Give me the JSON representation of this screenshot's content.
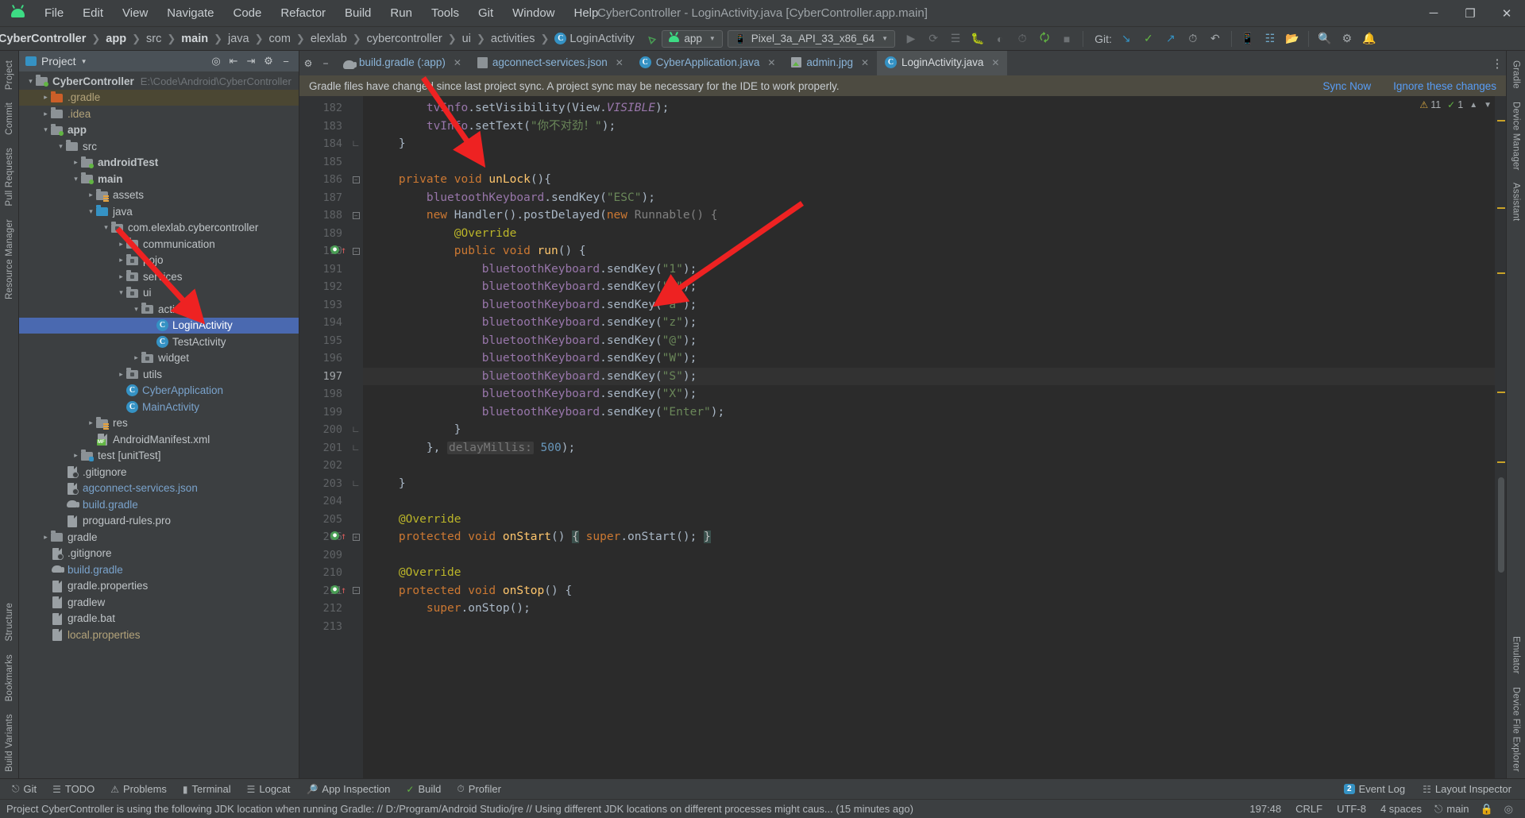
{
  "window": {
    "title": "CyberController - LoginActivity.java [CyberController.app.main]",
    "logo": "android-logo",
    "controls": {
      "minimize": "─",
      "maximize": "❐",
      "close": "✕"
    }
  },
  "menubar": {
    "items": [
      "File",
      "Edit",
      "View",
      "Navigate",
      "Code",
      "Refactor",
      "Build",
      "Run",
      "Tools",
      "Git",
      "Window",
      "Help"
    ]
  },
  "navbar": {
    "breadcrumbs": [
      "CyberController",
      "app",
      "src",
      "main",
      "java",
      "com",
      "elexlab",
      "cybercontroller",
      "ui",
      "activities",
      "LoginActivity"
    ],
    "module_selector": "app",
    "device_selector": "Pixel_3a_API_33_x86_64",
    "git_label": "Git:",
    "icons": [
      "run-icon",
      "rerun-icon",
      "apply-changes-icon",
      "debug-icon",
      "coverage-icon",
      "profiler-icon",
      "sync-gradle-icon",
      "stop-icon",
      "git-update-icon",
      "git-commit-icon",
      "git-push-icon",
      "history-icon",
      "undo-icon",
      "avd-manager-icon",
      "sdk-manager-icon",
      "device-explorer-icon",
      "search-icon",
      "settings-icon",
      "notifications-icon"
    ]
  },
  "project_panel": {
    "title": "Project",
    "header_icons": [
      "locate-icon",
      "expand-all-icon",
      "collapse-all-icon",
      "settings-icon",
      "hide-icon"
    ],
    "tree": [
      {
        "label": "CyberController",
        "path": "E:\\Code\\Android\\CyberController",
        "depth": 0,
        "arrow": "down",
        "icon": "module-folder",
        "bold": true
      },
      {
        "label": ".gradle",
        "depth": 1,
        "arrow": "right",
        "icon": "folder-orange",
        "color": "orange",
        "highlight": true
      },
      {
        "label": ".idea",
        "depth": 1,
        "arrow": "right",
        "icon": "folder",
        "color": "orange"
      },
      {
        "label": "app",
        "depth": 1,
        "arrow": "down",
        "icon": "module-folder",
        "bold": true
      },
      {
        "label": "src",
        "depth": 2,
        "arrow": "down",
        "icon": "folder"
      },
      {
        "label": "androidTest",
        "depth": 3,
        "arrow": "right",
        "icon": "module-folder",
        "bold": true
      },
      {
        "label": "main",
        "depth": 3,
        "arrow": "down",
        "icon": "module-folder",
        "bold": true
      },
      {
        "label": "assets",
        "depth": 4,
        "arrow": "right",
        "icon": "folder-res"
      },
      {
        "label": "java",
        "depth": 4,
        "arrow": "down",
        "icon": "folder-blue"
      },
      {
        "label": "com.elexlab.cybercontroller",
        "depth": 5,
        "arrow": "down",
        "icon": "package-folder"
      },
      {
        "label": "communication",
        "depth": 6,
        "arrow": "right",
        "icon": "package-folder"
      },
      {
        "label": "pojo",
        "depth": 6,
        "arrow": "right",
        "icon": "package-folder"
      },
      {
        "label": "services",
        "depth": 6,
        "arrow": "right",
        "icon": "package-folder"
      },
      {
        "label": "ui",
        "depth": 6,
        "arrow": "down",
        "icon": "package-folder"
      },
      {
        "label": "activities",
        "depth": 7,
        "arrow": "down",
        "icon": "package-folder"
      },
      {
        "label": "LoginActivity",
        "depth": 8,
        "arrow": "none",
        "icon": "java-class",
        "selected": true
      },
      {
        "label": "TestActivity",
        "depth": 8,
        "arrow": "none",
        "icon": "java-class"
      },
      {
        "label": "widget",
        "depth": 7,
        "arrow": "right",
        "icon": "package-folder"
      },
      {
        "label": "utils",
        "depth": 6,
        "arrow": "right",
        "icon": "package-folder"
      },
      {
        "label": "CyberApplication",
        "depth": 6,
        "arrow": "none",
        "icon": "java-class",
        "color": "blue"
      },
      {
        "label": "MainActivity",
        "depth": 6,
        "arrow": "none",
        "icon": "java-class",
        "color": "blue"
      },
      {
        "label": "res",
        "depth": 4,
        "arrow": "right",
        "icon": "folder-res"
      },
      {
        "label": "AndroidManifest.xml",
        "depth": 4,
        "arrow": "none",
        "icon": "manifest-file"
      },
      {
        "label": "test [unitTest]",
        "depth": 3,
        "arrow": "right",
        "icon": "test-folder",
        "bold_suffix": true
      },
      {
        "label": ".gitignore",
        "depth": 2,
        "arrow": "none",
        "icon": "gitignore-file"
      },
      {
        "label": "agconnect-services.json",
        "depth": 2,
        "arrow": "none",
        "icon": "json-file",
        "color": "blue"
      },
      {
        "label": "build.gradle",
        "depth": 2,
        "arrow": "none",
        "icon": "gradle-file",
        "color": "blue"
      },
      {
        "label": "proguard-rules.pro",
        "depth": 2,
        "arrow": "none",
        "icon": "text-file"
      },
      {
        "label": "gradle",
        "depth": 1,
        "arrow": "right",
        "icon": "folder"
      },
      {
        "label": ".gitignore",
        "depth": 1,
        "arrow": "none",
        "icon": "gitignore-file"
      },
      {
        "label": "build.gradle",
        "depth": 1,
        "arrow": "none",
        "icon": "gradle-file",
        "color": "blue"
      },
      {
        "label": "gradle.properties",
        "depth": 1,
        "arrow": "none",
        "icon": "properties-file"
      },
      {
        "label": "gradlew",
        "depth": 1,
        "arrow": "none",
        "icon": "text-file"
      },
      {
        "label": "gradle.bat",
        "depth": 1,
        "arrow": "none",
        "icon": "text-file"
      },
      {
        "label": "local.properties",
        "depth": 1,
        "arrow": "none",
        "icon": "properties-file",
        "color": "orange"
      }
    ]
  },
  "left_rail": [
    "Project",
    "Commit",
    "Pull Requests",
    "Resource Manager",
    "Structure",
    "Bookmarks",
    "Build Variants"
  ],
  "right_rail": [
    "Gradle",
    "Device Manager",
    "Assistant",
    "Emulator",
    "Device File Explorer"
  ],
  "editor": {
    "tabs": [
      {
        "label": "build.gradle (:app)",
        "icon": "gradle-file",
        "active": false
      },
      {
        "label": "agconnect-services.json",
        "icon": "json-file",
        "active": false
      },
      {
        "label": "CyberApplication.java",
        "icon": "java-class",
        "active": false
      },
      {
        "label": "admin.jpg",
        "icon": "image-file",
        "active": false
      },
      {
        "label": "LoginActivity.java",
        "icon": "java-class",
        "active": true
      }
    ],
    "notification": {
      "message": "Gradle files have changed since last project sync. A project sync may be necessary for the IDE to work properly.",
      "sync_action": "Sync Now",
      "ignore_action": "Ignore these changes"
    },
    "inspection": {
      "warnings": "11",
      "errors": "1",
      "warn_icon": "warning-triangle-icon",
      "ok_icon": "check-icon"
    },
    "lines": [
      {
        "n": "182",
        "indent": 8,
        "tokens": [
          [
            "fld2",
            "tvInfo"
          ],
          [
            "pl",
            ".setVisibility(View."
          ],
          [
            "stat",
            "VISIBLE"
          ],
          [
            "pl",
            ");"
          ]
        ]
      },
      {
        "n": "183",
        "indent": 8,
        "tokens": [
          [
            "fld2",
            "tvInfo"
          ],
          [
            "pl",
            ".setText("
          ],
          [
            "str",
            "\"你不对劲！\""
          ],
          [
            "pl",
            ");"
          ]
        ]
      },
      {
        "n": "184",
        "indent": 4,
        "fold": "end",
        "tokens": [
          [
            "pl",
            "}"
          ]
        ]
      },
      {
        "n": "185",
        "indent": 0,
        "tokens": []
      },
      {
        "n": "186",
        "indent": 4,
        "fold": "start",
        "tokens": [
          [
            "kw",
            "private void "
          ],
          [
            "fn",
            "unLock"
          ],
          [
            "pl",
            "(){"
          ]
        ]
      },
      {
        "n": "187",
        "indent": 8,
        "tokens": [
          [
            "fld2",
            "bluetoothKeyboard"
          ],
          [
            "pl",
            ".sendKey("
          ],
          [
            "str",
            "\"ESC\""
          ],
          [
            "pl",
            ");"
          ]
        ]
      },
      {
        "n": "188",
        "indent": 8,
        "fold": "start",
        "tokens": [
          [
            "kw",
            "new "
          ],
          [
            "pl",
            "Handler().postDelayed("
          ],
          [
            "kw",
            "new "
          ],
          [
            "gray",
            "Runnable() {"
          ]
        ]
      },
      {
        "n": "189",
        "indent": 12,
        "tokens": [
          [
            "anno",
            "@Override"
          ]
        ]
      },
      {
        "n": "190",
        "indent": 12,
        "run_marker": true,
        "fold": "start",
        "tokens": [
          [
            "kw",
            "public void "
          ],
          [
            "fn",
            "run"
          ],
          [
            "pl",
            "() {"
          ]
        ]
      },
      {
        "n": "191",
        "indent": 16,
        "tokens": [
          [
            "fld2",
            "bluetoothKeyboard"
          ],
          [
            "pl",
            ".sendKey("
          ],
          [
            "str",
            "\"1\""
          ],
          [
            "pl",
            ");"
          ]
        ]
      },
      {
        "n": "192",
        "indent": 16,
        "tokens": [
          [
            "fld2",
            "bluetoothKeyboard"
          ],
          [
            "pl",
            ".sendKey("
          ],
          [
            "str",
            "\"q\""
          ],
          [
            "pl",
            ");"
          ]
        ]
      },
      {
        "n": "193",
        "indent": 16,
        "tokens": [
          [
            "fld2",
            "bluetoothKeyboard"
          ],
          [
            "pl",
            ".sendKey("
          ],
          [
            "str",
            "\"a\""
          ],
          [
            "pl",
            ");"
          ]
        ]
      },
      {
        "n": "194",
        "indent": 16,
        "tokens": [
          [
            "fld2",
            "bluetoothKeyboard"
          ],
          [
            "pl",
            ".sendKey("
          ],
          [
            "str",
            "\"z\""
          ],
          [
            "pl",
            ");"
          ]
        ]
      },
      {
        "n": "195",
        "indent": 16,
        "tokens": [
          [
            "fld2",
            "bluetoothKeyboard"
          ],
          [
            "pl",
            ".sendKey("
          ],
          [
            "str",
            "\"@\""
          ],
          [
            "pl",
            ");"
          ]
        ]
      },
      {
        "n": "196",
        "indent": 16,
        "tokens": [
          [
            "fld2",
            "bluetoothKeyboard"
          ],
          [
            "pl",
            ".sendKey("
          ],
          [
            "str",
            "\"W\""
          ],
          [
            "pl",
            ");"
          ]
        ]
      },
      {
        "n": "197",
        "indent": 16,
        "current": true,
        "tokens": [
          [
            "fld2",
            "bluetoothKeyboard"
          ],
          [
            "pl",
            ".sendKey("
          ],
          [
            "str",
            "\"S\""
          ],
          [
            "pl",
            ");"
          ]
        ]
      },
      {
        "n": "198",
        "indent": 16,
        "tokens": [
          [
            "fld2",
            "bluetoothKeyboard"
          ],
          [
            "pl",
            ".sendKey("
          ],
          [
            "str",
            "\"X\""
          ],
          [
            "pl",
            ");"
          ]
        ]
      },
      {
        "n": "199",
        "indent": 16,
        "tokens": [
          [
            "fld2",
            "bluetoothKeyboard"
          ],
          [
            "pl",
            ".sendKey("
          ],
          [
            "str",
            "\"Enter\""
          ],
          [
            "pl",
            ");"
          ]
        ]
      },
      {
        "n": "200",
        "indent": 12,
        "fold": "end",
        "tokens": [
          [
            "pl",
            "}"
          ]
        ]
      },
      {
        "n": "201",
        "indent": 8,
        "fold": "end",
        "tokens": [
          [
            "pl",
            "}, "
          ],
          [
            "hint",
            "delayMillis:"
          ],
          [
            "pl",
            " "
          ],
          [
            "num",
            "500"
          ],
          [
            "pl",
            ");"
          ]
        ]
      },
      {
        "n": "202",
        "indent": 0,
        "tokens": []
      },
      {
        "n": "203",
        "indent": 4,
        "fold": "end",
        "tokens": [
          [
            "pl",
            "}"
          ]
        ]
      },
      {
        "n": "204",
        "indent": 0,
        "tokens": []
      },
      {
        "n": "205",
        "indent": 4,
        "tokens": [
          [
            "anno",
            "@Override"
          ]
        ]
      },
      {
        "n": "206",
        "indent": 4,
        "run_marker": true,
        "fold": "box",
        "tokens": [
          [
            "kw",
            "protected void "
          ],
          [
            "fn",
            "onStart"
          ],
          [
            "pl",
            "() "
          ],
          [
            "brace",
            "{"
          ],
          [
            "pl",
            " "
          ],
          [
            "kw2",
            "super"
          ],
          [
            "pl",
            ".onStart(); "
          ],
          [
            "brace",
            "}"
          ]
        ]
      },
      {
        "n": "209",
        "indent": 0,
        "tokens": []
      },
      {
        "n": "210",
        "indent": 4,
        "tokens": [
          [
            "anno",
            "@Override"
          ]
        ]
      },
      {
        "n": "211",
        "indent": 4,
        "run_marker": true,
        "fold": "start",
        "tokens": [
          [
            "kw",
            "protected void "
          ],
          [
            "fn",
            "onStop"
          ],
          [
            "pl",
            "() {"
          ]
        ]
      },
      {
        "n": "212",
        "indent": 8,
        "tokens": [
          [
            "kw2",
            "super"
          ],
          [
            "pl",
            ".onStop();"
          ]
        ]
      },
      {
        "n": "213",
        "indent": 0,
        "tokens": []
      }
    ]
  },
  "bottom_tools": [
    {
      "label": "Git",
      "icon": "git-icon"
    },
    {
      "label": "TODO",
      "icon": "todo-icon"
    },
    {
      "label": "Problems",
      "icon": "problems-icon"
    },
    {
      "label": "Terminal",
      "icon": "terminal-icon"
    },
    {
      "label": "Logcat",
      "icon": "logcat-icon"
    },
    {
      "label": "App Inspection",
      "icon": "inspection-icon"
    },
    {
      "label": "Build",
      "icon": "build-icon"
    },
    {
      "label": "Profiler",
      "icon": "profiler-icon"
    }
  ],
  "bottom_right": [
    {
      "label": "Event Log",
      "badge": "2",
      "icon": "event-log-icon"
    },
    {
      "label": "Layout Inspector",
      "icon": "layout-inspector-icon"
    }
  ],
  "statusbar": {
    "message": "Project CyberController is using the following JDK location when running Gradle: // D:/Program/Android Studio/jre // Using different JDK locations on different processes might caus... (15 minutes ago)",
    "caret": "197:48",
    "line_separator": "CRLF",
    "encoding": "UTF-8",
    "indent": "4 spaces",
    "branch": "main",
    "branch_icon": "git-branch-icon",
    "lock_icon": "lock-icon",
    "inspect_icon": "inspection-eye-icon"
  },
  "colors": {
    "accent_blue": "#3592c4",
    "selection": "#4a69b0",
    "string_green": "#6a8759",
    "keyword_orange": "#cc7832",
    "field_purple": "#9876aa",
    "method_yellow": "#ffc66d",
    "annotation_yellow": "#bbb529",
    "arrow_red": "#ee2222",
    "notification_bg": "#4d4b41"
  }
}
